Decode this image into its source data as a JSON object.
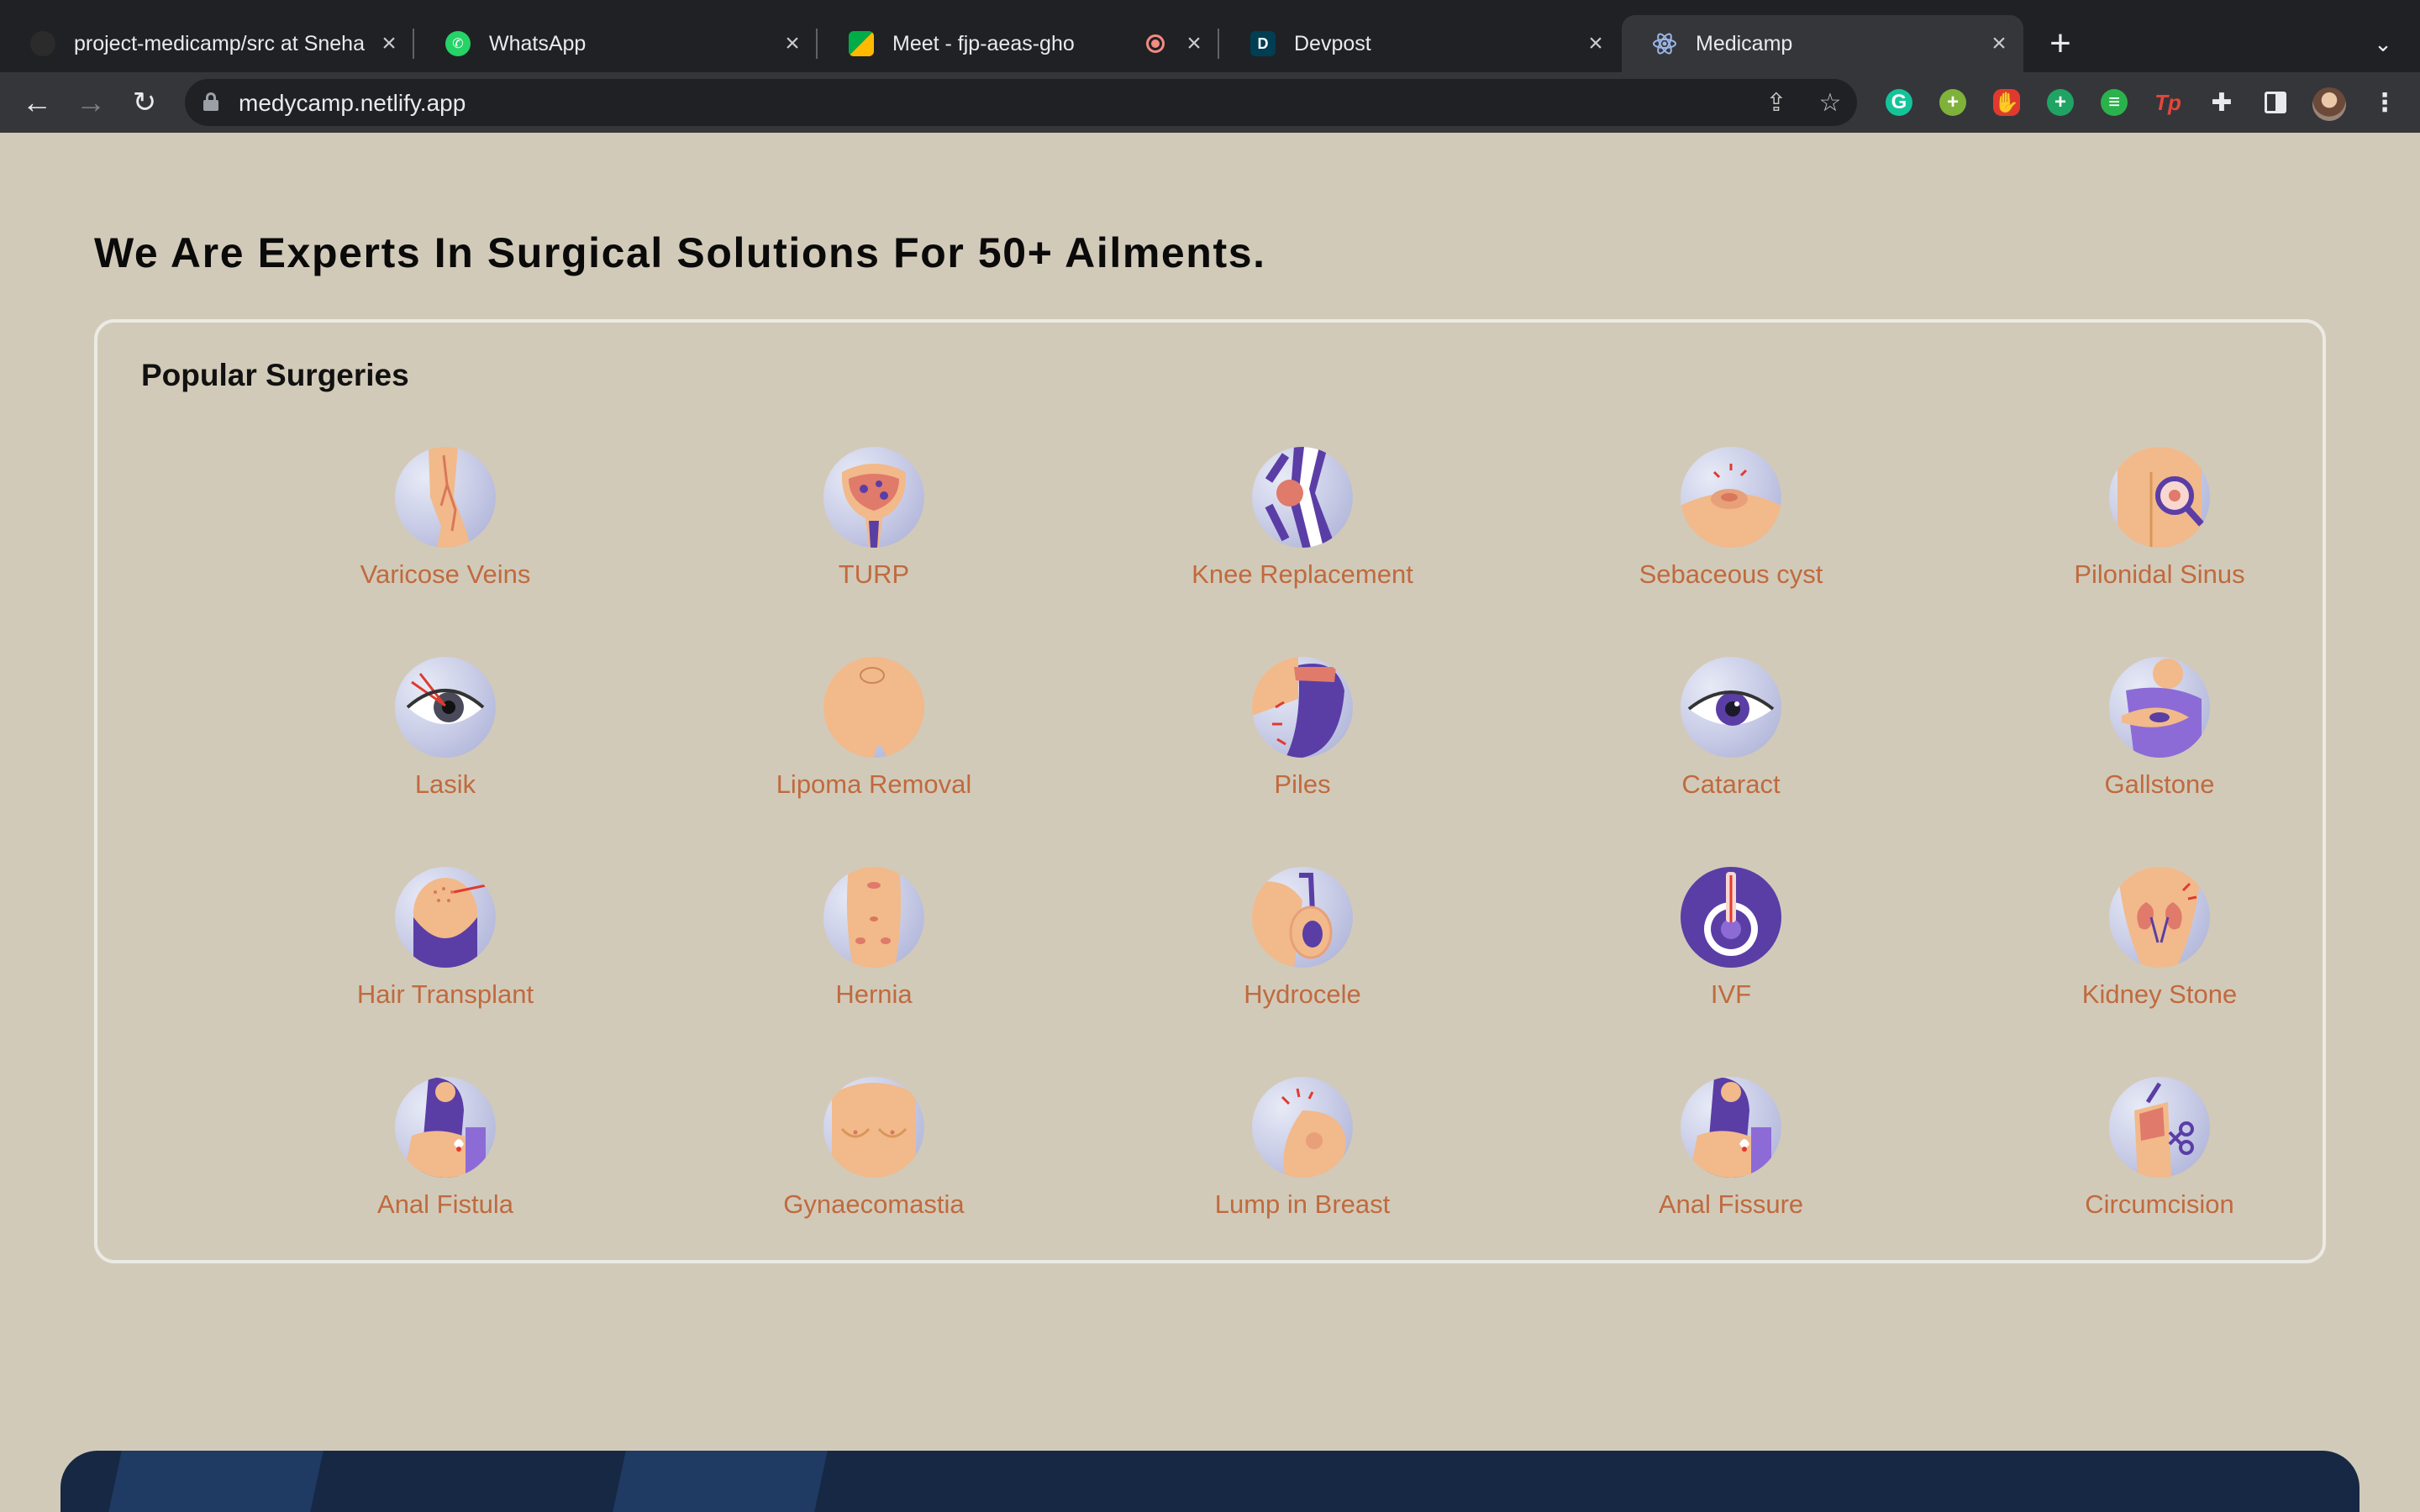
{
  "browser": {
    "tabs": [
      {
        "title": "project-medicamp/src at Sneha",
        "favicon": "github-icon"
      },
      {
        "title": "WhatsApp",
        "favicon": "whatsapp-icon"
      },
      {
        "title": "Meet - fjp-aeas-gho",
        "favicon": "google-meet-icon",
        "recording": true
      },
      {
        "title": "Devpost",
        "favicon": "devpost-icon",
        "favicon_letter": "D"
      },
      {
        "title": "Medicamp",
        "favicon": "react-icon",
        "active": true
      }
    ],
    "new_tab_label": "+",
    "address": "medycamp.netlify.app",
    "extensions": [
      "grammarly-icon",
      "add-green-icon",
      "adblock-icon",
      "add-circle-icon",
      "chat-bubble-icon",
      "tp-icon",
      "puzzle-extensions-icon",
      "sidebar-icon"
    ],
    "tp_label": "Tp"
  },
  "page": {
    "heading": "We Are Experts In Surgical Solutions For 50+ Ailments.",
    "section_title": "Popular Surgeries",
    "surgeries": [
      "Varicose Veins",
      "TURP",
      "Knee Replacement",
      "Sebaceous cyst",
      "Pilonidal Sinus",
      "Lasik",
      "Lipoma Removal",
      "Piles",
      "Cataract",
      "Gallstone",
      "Hair Transplant",
      "Hernia",
      "Hydrocele",
      "IVF",
      "Kidney Stone",
      "Anal Fistula",
      "Gynaecomastia",
      "Lump in Breast",
      "Anal Fissure",
      "Circumcision"
    ]
  },
  "colors": {
    "page_bg": "#d2cab8",
    "label": "#c06a3f",
    "skin": "#f2b98a",
    "purple": "#5a3ea6",
    "footer": "#172844"
  }
}
